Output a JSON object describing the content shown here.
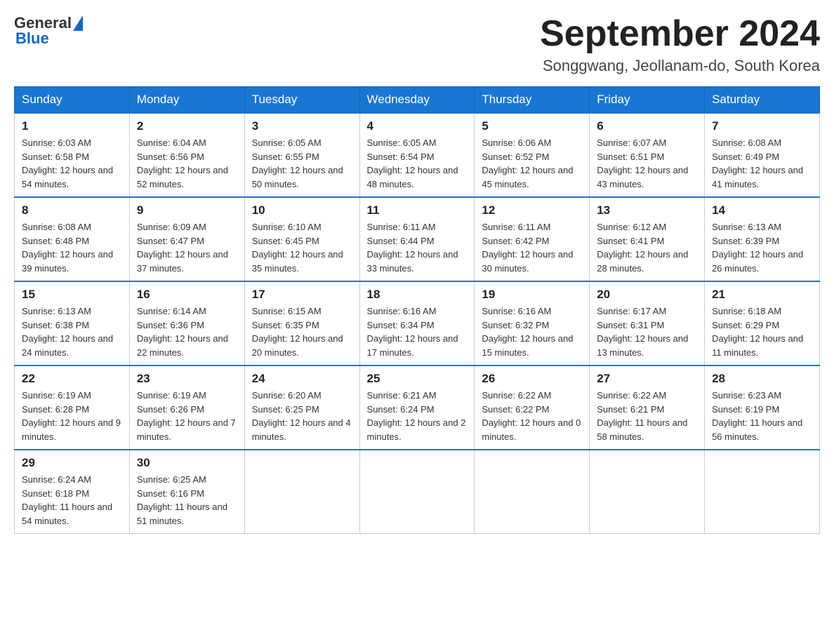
{
  "header": {
    "logo_general": "General",
    "logo_blue": "Blue",
    "month_title": "September 2024",
    "location": "Songgwang, Jeollanam-do, South Korea"
  },
  "weekdays": [
    "Sunday",
    "Monday",
    "Tuesday",
    "Wednesday",
    "Thursday",
    "Friday",
    "Saturday"
  ],
  "weeks": [
    [
      {
        "day": "1",
        "sunrise": "6:03 AM",
        "sunset": "6:58 PM",
        "daylight": "12 hours and 54 minutes."
      },
      {
        "day": "2",
        "sunrise": "6:04 AM",
        "sunset": "6:56 PM",
        "daylight": "12 hours and 52 minutes."
      },
      {
        "day": "3",
        "sunrise": "6:05 AM",
        "sunset": "6:55 PM",
        "daylight": "12 hours and 50 minutes."
      },
      {
        "day": "4",
        "sunrise": "6:05 AM",
        "sunset": "6:54 PM",
        "daylight": "12 hours and 48 minutes."
      },
      {
        "day": "5",
        "sunrise": "6:06 AM",
        "sunset": "6:52 PM",
        "daylight": "12 hours and 45 minutes."
      },
      {
        "day": "6",
        "sunrise": "6:07 AM",
        "sunset": "6:51 PM",
        "daylight": "12 hours and 43 minutes."
      },
      {
        "day": "7",
        "sunrise": "6:08 AM",
        "sunset": "6:49 PM",
        "daylight": "12 hours and 41 minutes."
      }
    ],
    [
      {
        "day": "8",
        "sunrise": "6:08 AM",
        "sunset": "6:48 PM",
        "daylight": "12 hours and 39 minutes."
      },
      {
        "day": "9",
        "sunrise": "6:09 AM",
        "sunset": "6:47 PM",
        "daylight": "12 hours and 37 minutes."
      },
      {
        "day": "10",
        "sunrise": "6:10 AM",
        "sunset": "6:45 PM",
        "daylight": "12 hours and 35 minutes."
      },
      {
        "day": "11",
        "sunrise": "6:11 AM",
        "sunset": "6:44 PM",
        "daylight": "12 hours and 33 minutes."
      },
      {
        "day": "12",
        "sunrise": "6:11 AM",
        "sunset": "6:42 PM",
        "daylight": "12 hours and 30 minutes."
      },
      {
        "day": "13",
        "sunrise": "6:12 AM",
        "sunset": "6:41 PM",
        "daylight": "12 hours and 28 minutes."
      },
      {
        "day": "14",
        "sunrise": "6:13 AM",
        "sunset": "6:39 PM",
        "daylight": "12 hours and 26 minutes."
      }
    ],
    [
      {
        "day": "15",
        "sunrise": "6:13 AM",
        "sunset": "6:38 PM",
        "daylight": "12 hours and 24 minutes."
      },
      {
        "day": "16",
        "sunrise": "6:14 AM",
        "sunset": "6:36 PM",
        "daylight": "12 hours and 22 minutes."
      },
      {
        "day": "17",
        "sunrise": "6:15 AM",
        "sunset": "6:35 PM",
        "daylight": "12 hours and 20 minutes."
      },
      {
        "day": "18",
        "sunrise": "6:16 AM",
        "sunset": "6:34 PM",
        "daylight": "12 hours and 17 minutes."
      },
      {
        "day": "19",
        "sunrise": "6:16 AM",
        "sunset": "6:32 PM",
        "daylight": "12 hours and 15 minutes."
      },
      {
        "day": "20",
        "sunrise": "6:17 AM",
        "sunset": "6:31 PM",
        "daylight": "12 hours and 13 minutes."
      },
      {
        "day": "21",
        "sunrise": "6:18 AM",
        "sunset": "6:29 PM",
        "daylight": "12 hours and 11 minutes."
      }
    ],
    [
      {
        "day": "22",
        "sunrise": "6:19 AM",
        "sunset": "6:28 PM",
        "daylight": "12 hours and 9 minutes."
      },
      {
        "day": "23",
        "sunrise": "6:19 AM",
        "sunset": "6:26 PM",
        "daylight": "12 hours and 7 minutes."
      },
      {
        "day": "24",
        "sunrise": "6:20 AM",
        "sunset": "6:25 PM",
        "daylight": "12 hours and 4 minutes."
      },
      {
        "day": "25",
        "sunrise": "6:21 AM",
        "sunset": "6:24 PM",
        "daylight": "12 hours and 2 minutes."
      },
      {
        "day": "26",
        "sunrise": "6:22 AM",
        "sunset": "6:22 PM",
        "daylight": "12 hours and 0 minutes."
      },
      {
        "day": "27",
        "sunrise": "6:22 AM",
        "sunset": "6:21 PM",
        "daylight": "11 hours and 58 minutes."
      },
      {
        "day": "28",
        "sunrise": "6:23 AM",
        "sunset": "6:19 PM",
        "daylight": "11 hours and 56 minutes."
      }
    ],
    [
      {
        "day": "29",
        "sunrise": "6:24 AM",
        "sunset": "6:18 PM",
        "daylight": "11 hours and 54 minutes."
      },
      {
        "day": "30",
        "sunrise": "6:25 AM",
        "sunset": "6:16 PM",
        "daylight": "11 hours and 51 minutes."
      },
      null,
      null,
      null,
      null,
      null
    ]
  ]
}
